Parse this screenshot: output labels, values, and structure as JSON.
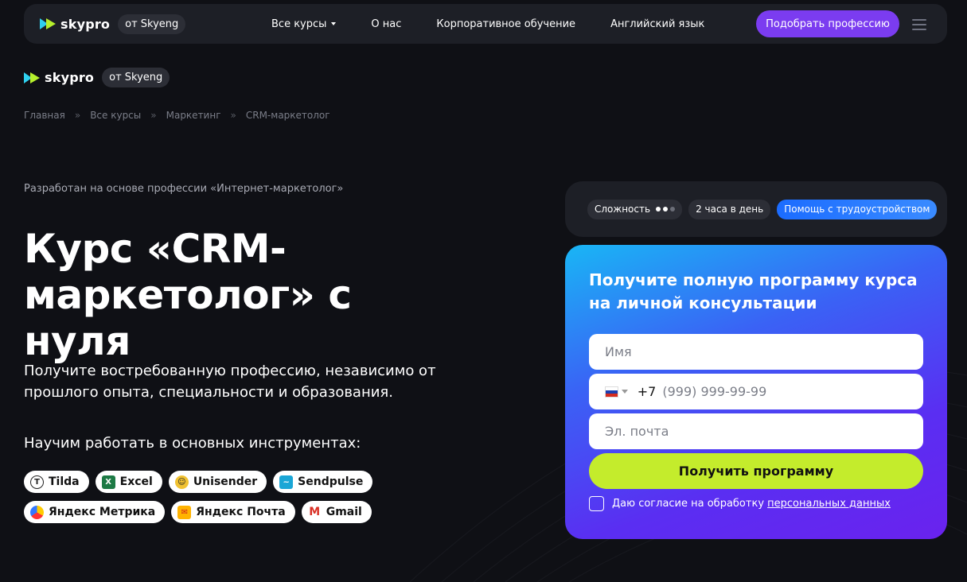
{
  "brand": {
    "logo_text": "skypro",
    "partner_badge": "от Skyeng"
  },
  "nav": {
    "links": [
      "Все курсы",
      "О нас",
      "Корпоративное обучение",
      "Английский язык"
    ],
    "cta": "Подобрать профессию"
  },
  "breadcrumb": [
    "Главная",
    "Все курсы",
    "Маркетинг",
    "CRM-маркетолог"
  ],
  "breadcrumb_sep": "»",
  "hero": {
    "developed": "Разработан на основе профессии «Интернет-маркетолог»",
    "title": "Курс «CRM-маркетолог» с нуля",
    "subtitle": "Получите востребованную профессию, независимо от прошлого опыта, специальности и образования.",
    "tools_title": "Научим работать в основных инструментах:"
  },
  "tools": [
    {
      "name": "Tilda",
      "icon": "tilda-icon"
    },
    {
      "name": "Excel",
      "icon": "excel-icon"
    },
    {
      "name": "Unisender",
      "icon": "unisender-icon"
    },
    {
      "name": "Sendpulse",
      "icon": "sendpulse-icon"
    },
    {
      "name": "Яндекс Метрика",
      "icon": "yandex-metrika-icon"
    },
    {
      "name": "Яндекс Почта",
      "icon": "yandex-mail-icon"
    },
    {
      "name": "Gmail",
      "icon": "gmail-icon"
    }
  ],
  "chips": {
    "difficulty_label": "Сложность",
    "difficulty_level": 2,
    "difficulty_max": 3,
    "hours": "2 часа в день",
    "job_help": "Помощь с трудоустройством"
  },
  "form": {
    "title": "Получите полную программу курса на личной консультации",
    "name_placeholder": "Имя",
    "phone_code": "+7",
    "phone_placeholder": "(999) 999-99-99",
    "email_placeholder": "Эл. почта",
    "submit": "Получить программу",
    "consent_text": "Даю согласие на обработку ",
    "consent_link": "персональных данных"
  },
  "colors": {
    "background": "#0f1015",
    "accent_purple": "#7b3cf0",
    "submit_green": "#c4ec2c",
    "chip_blue": "#1b6cff"
  }
}
